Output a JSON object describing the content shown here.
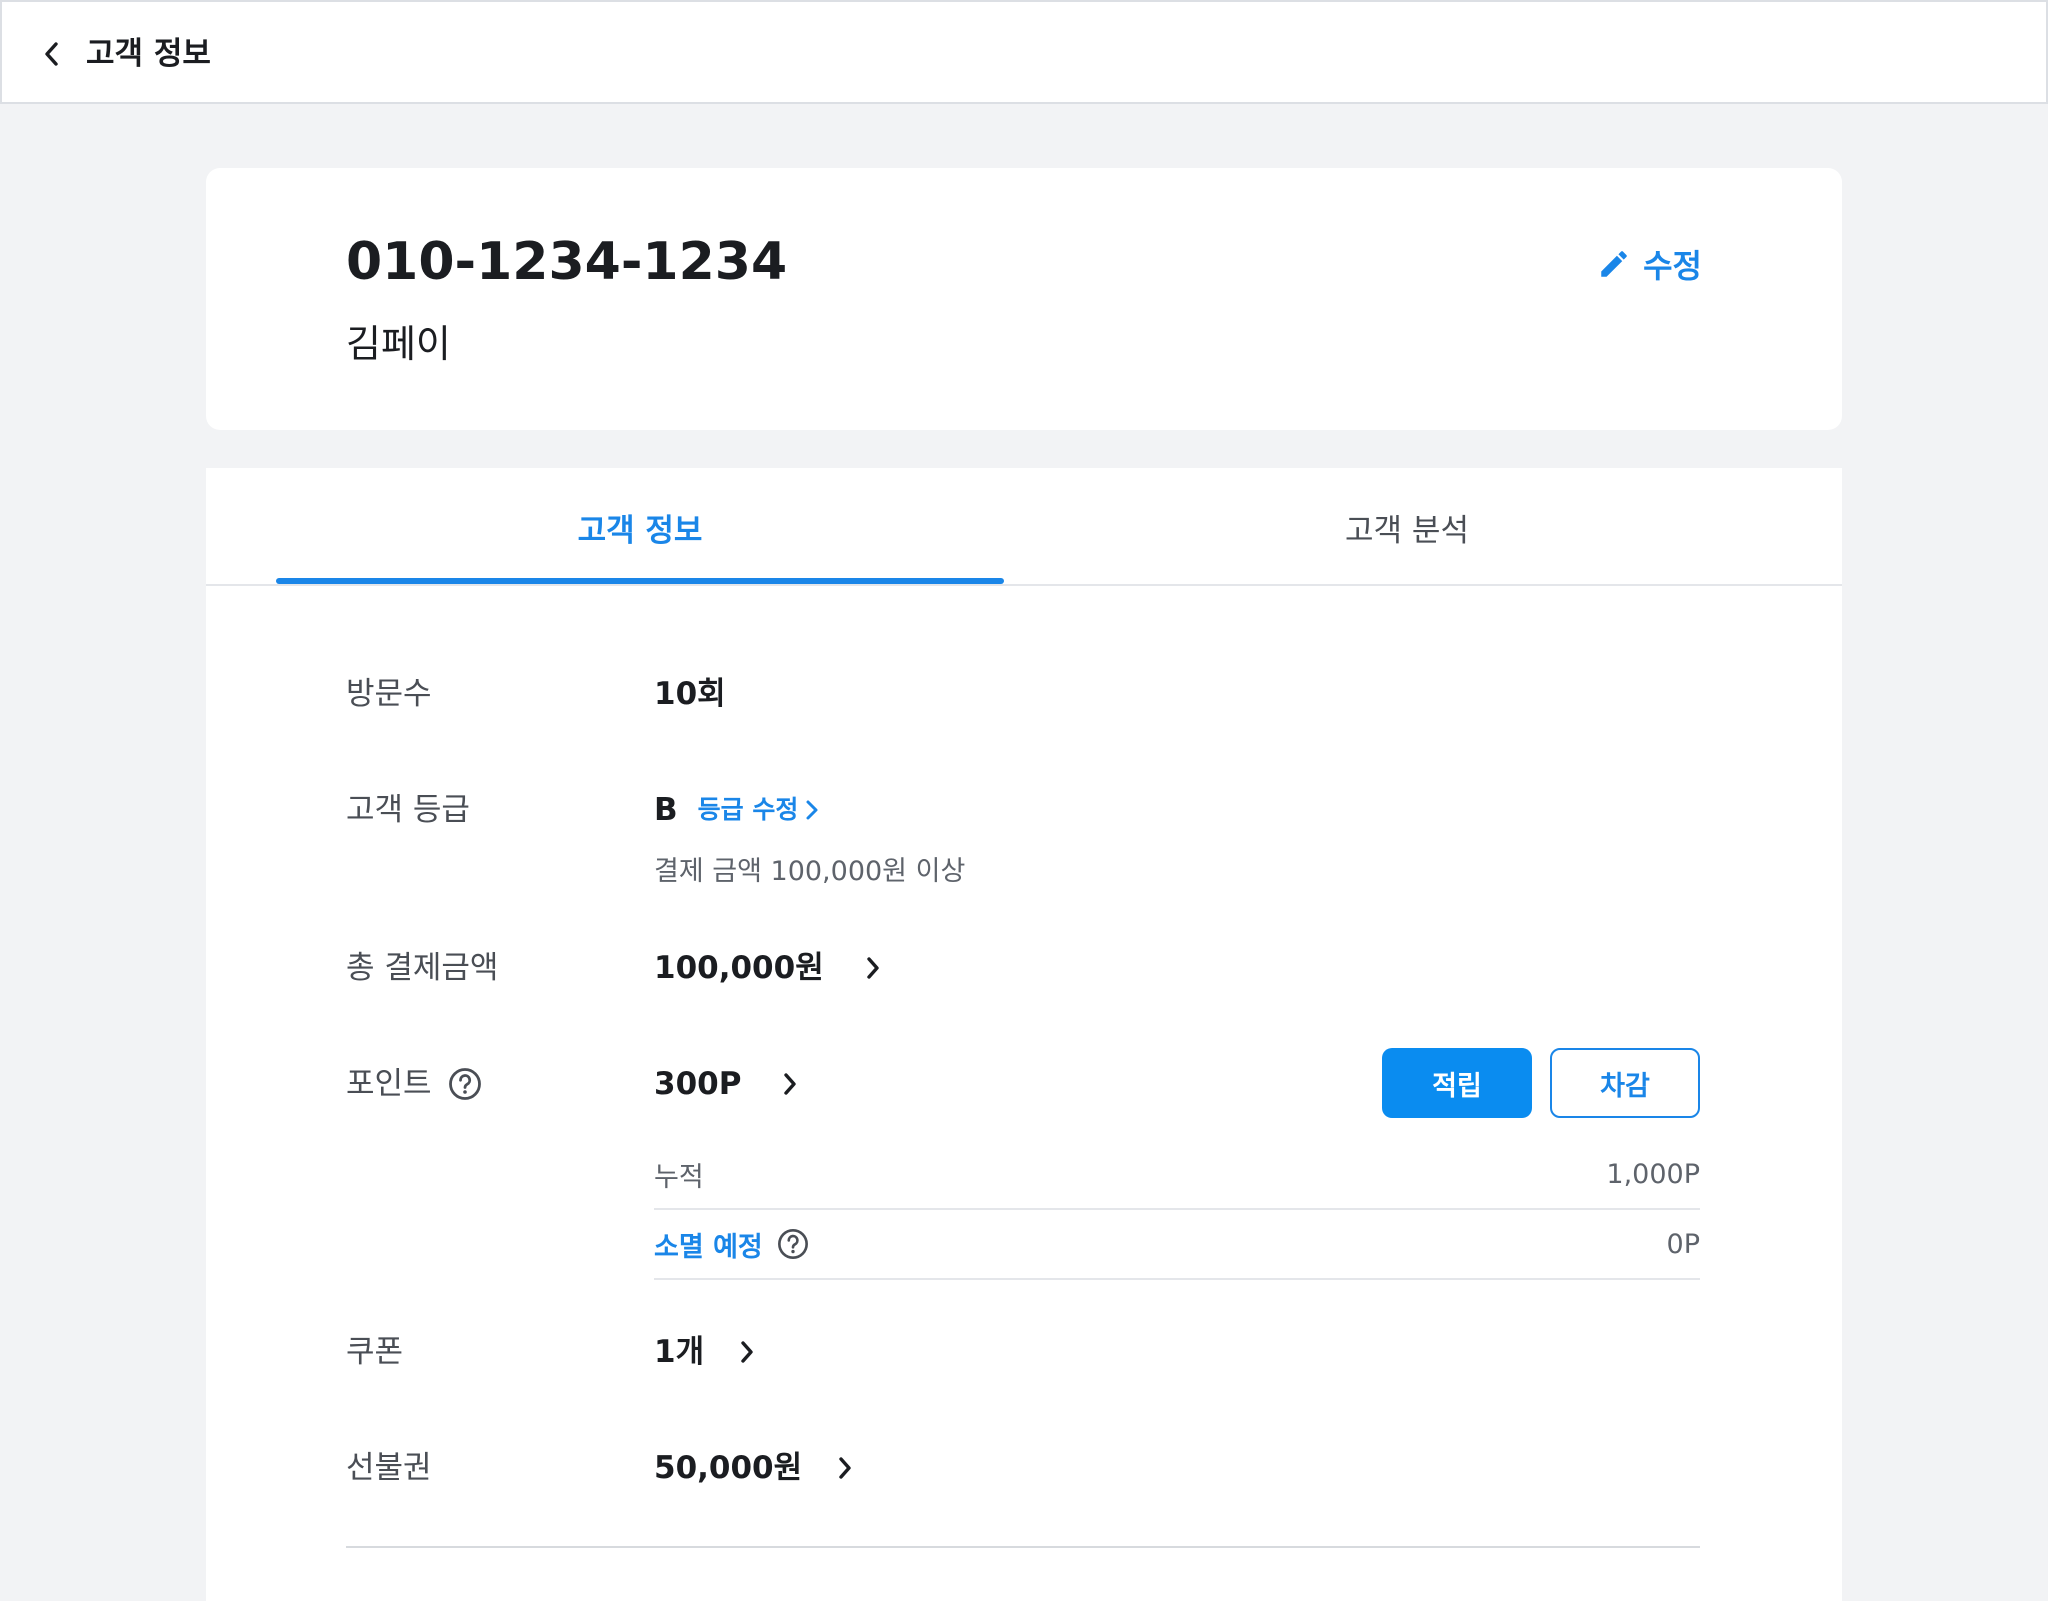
{
  "topbar": {
    "title": "고객 정보",
    "back_icon": "chevron-left-icon"
  },
  "customer": {
    "phone": "010-1234-1234",
    "name": "김페이",
    "edit_label": "수정",
    "edit_icon": "pencil-icon"
  },
  "tabs": [
    {
      "label": "고객 정보",
      "active": true
    },
    {
      "label": "고객 분석",
      "active": false
    }
  ],
  "info": {
    "visits": {
      "label": "방문수",
      "value": "10회"
    },
    "grade": {
      "label": "고객 등급",
      "value": "B",
      "edit_label": "등급 수정",
      "description": "결제 금액 100,000원 이상"
    },
    "total_payment": {
      "label": "총 결제금액",
      "value": "100,000원"
    },
    "points": {
      "label": "포인트",
      "value": "300P",
      "earn_label": "적립",
      "deduct_label": "차감",
      "accumulated_label": "누적",
      "accumulated_value": "1,000P",
      "expiring_label": "소멸 예정",
      "expiring_value": "0P"
    },
    "coupons": {
      "label": "쿠폰",
      "value": "1개"
    },
    "prepaid": {
      "label": "선불권",
      "value": "50,000원"
    }
  },
  "colors": {
    "accent": "#1a86e8",
    "button_primary": "#0a8cf0",
    "background": "#f2f3f5"
  }
}
